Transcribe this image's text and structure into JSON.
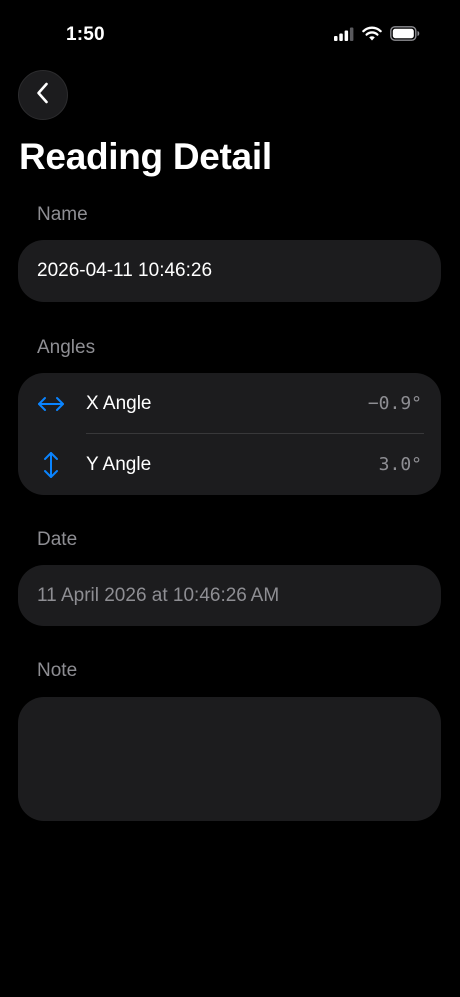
{
  "status_bar": {
    "time": "1:50",
    "icons": [
      "signal-icon",
      "wifi-icon",
      "battery-icon"
    ]
  },
  "nav": {
    "back_icon": "chevron-left-icon"
  },
  "page": {
    "title": "Reading Detail"
  },
  "name_section": {
    "header": "Name",
    "value": "2026-04-11 10:46:26"
  },
  "angles_section": {
    "header": "Angles",
    "rows": [
      {
        "icon": "horizontal-arrows-icon",
        "label": "X Angle",
        "value": "−0.9°"
      },
      {
        "icon": "vertical-arrows-icon",
        "label": "Y Angle",
        "value": "3.0°"
      }
    ]
  },
  "date_section": {
    "header": "Date",
    "value": "11 April 2026 at 10:46:26 AM"
  },
  "note_section": {
    "header": "Note",
    "value": ""
  },
  "colors": {
    "background": "#000000",
    "card": "#1c1c1e",
    "secondary_text": "#8e8e93",
    "accent": "#0a84ff"
  }
}
